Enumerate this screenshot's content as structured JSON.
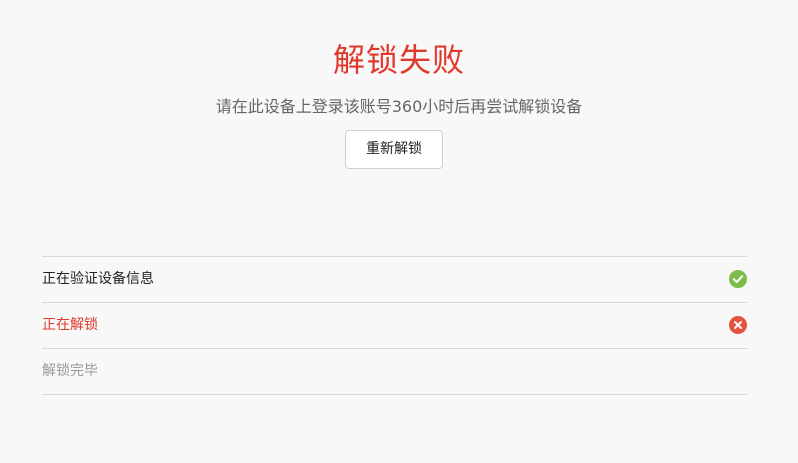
{
  "result": {
    "title": "解锁失败",
    "message": "请在此设备上登录该账号360小时后再尝试解锁设备",
    "retry_label": "重新解锁"
  },
  "steps": [
    {
      "label": "正在验证设备信息",
      "status": "success",
      "icon": "check-circle-icon"
    },
    {
      "label": "正在解锁",
      "status": "error",
      "icon": "close-circle-icon"
    },
    {
      "label": "解锁完毕",
      "status": "pending"
    }
  ],
  "colors": {
    "error": "#e0392b",
    "success": "#7dbb4b",
    "muted": "#999999",
    "divider": "#d9d9d9"
  }
}
